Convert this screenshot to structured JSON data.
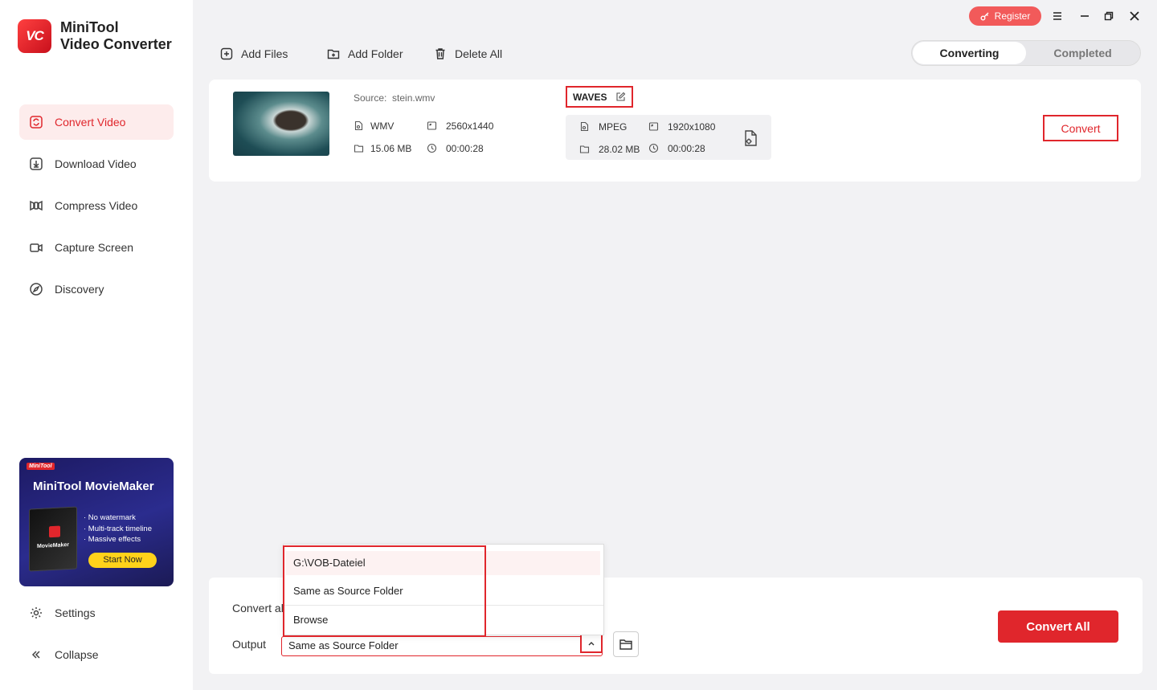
{
  "app": {
    "name_line1": "MiniTool",
    "name_line2": "Video Converter",
    "logo_text": "VC",
    "accent_color": "#e0262c"
  },
  "sidebar": {
    "items": [
      {
        "label": "Convert Video",
        "icon": "convert-icon",
        "active": true
      },
      {
        "label": "Download Video",
        "icon": "download-icon",
        "active": false
      },
      {
        "label": "Compress Video",
        "icon": "compress-icon",
        "active": false
      },
      {
        "label": "Capture Screen",
        "icon": "camera-icon",
        "active": false
      },
      {
        "label": "Discovery",
        "icon": "compass-icon",
        "active": false
      }
    ],
    "settings_label": "Settings",
    "collapse_label": "Collapse"
  },
  "promo": {
    "badge": "MiniTool",
    "title": "MiniTool MovieMaker",
    "box_label": "MovieMaker",
    "features": [
      "· No watermark",
      "· Multi-track timeline",
      "· Massive effects"
    ],
    "button": "Start Now"
  },
  "header": {
    "register_label": "Register"
  },
  "toolbar": {
    "add_files": "Add Files",
    "add_folder": "Add Folder",
    "delete_all": "Delete All"
  },
  "tabs": {
    "converting": "Converting",
    "completed": "Completed"
  },
  "task": {
    "source_label": "Source:",
    "source_name": "stein.wmv",
    "source": {
      "format": "WMV",
      "resolution": "2560x1440",
      "size": "15.06 MB",
      "duration": "00:00:28"
    },
    "target_name": "WAVES",
    "target": {
      "format": "MPEG",
      "resolution": "1920x1080",
      "size": "28.02 MB",
      "duration": "00:00:28"
    },
    "convert_label": "Convert"
  },
  "bottom": {
    "convert_all_to_label": "Convert al",
    "output_label": "Output",
    "output_value": "Same as Source Folder",
    "convert_all_button": "Convert All"
  },
  "dropdown": {
    "options": [
      "G:\\VOB-Dateiel",
      "Same as Source Folder",
      "Browse"
    ]
  }
}
